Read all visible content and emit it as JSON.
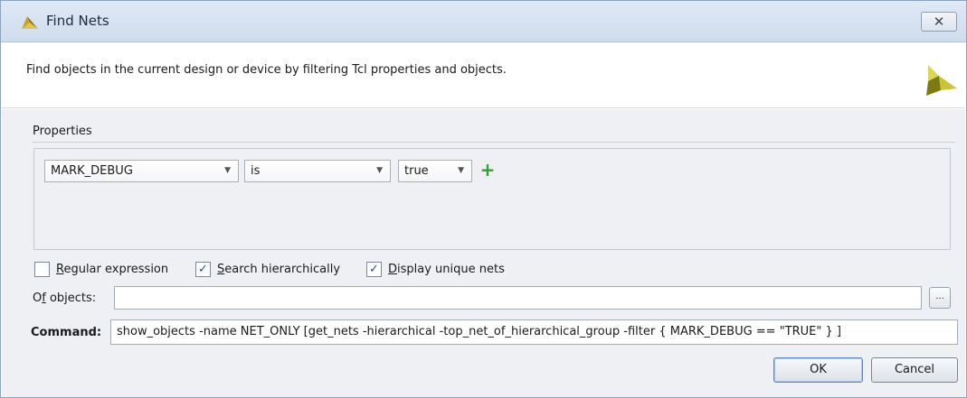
{
  "window": {
    "title": "Find Nets",
    "close_label": "✕"
  },
  "header": {
    "description": "Find objects in the current design or device by filtering Tcl properties and objects."
  },
  "properties": {
    "label": "Properties",
    "filter": {
      "property": "MARK_DEBUG",
      "operator": "is",
      "value": "true"
    },
    "add_label": "+"
  },
  "options": {
    "regular_expression": {
      "prefix": "",
      "mnemonic": "R",
      "rest": "egular expression",
      "checked": false
    },
    "search_hierarchically": {
      "prefix": "",
      "mnemonic": "S",
      "rest": "earch hierarchically",
      "checked": true
    },
    "display_unique_nets": {
      "prefix": "",
      "mnemonic": "D",
      "rest": "isplay unique nets",
      "checked": true
    }
  },
  "of_objects": {
    "label_prefix": "O",
    "label_mnemonic": "f",
    "label_rest": " objects:",
    "value": "",
    "browse_label": "..."
  },
  "command": {
    "label": "Command:",
    "value": "show_objects -name NET_ONLY [get_nets -hierarchical -top_net_of_hierarchical_group -filter { MARK_DEBUG == \"TRUE\" } ]"
  },
  "buttons": {
    "ok": "OK",
    "cancel": "Cancel"
  },
  "colors": {
    "titlebar": "#d6e2f1",
    "body": "#eef0f3",
    "add_icon": "#2ea12e",
    "checkmark": "#2b4aa8"
  }
}
